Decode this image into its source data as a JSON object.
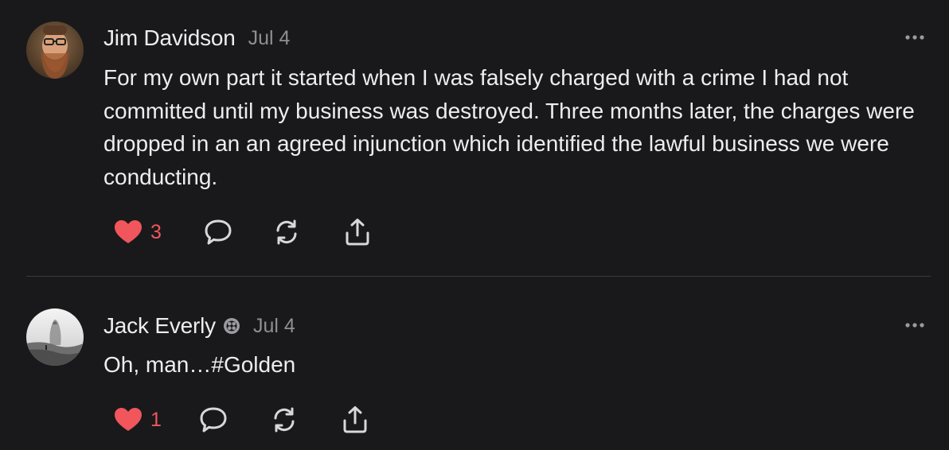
{
  "posts": [
    {
      "author": "Jim Davidson",
      "date": "Jul 4",
      "text": "For my own part it started when I was falsely charged with a crime I had not committed until my business was destroyed. Three months later, the charges were dropped in an an agreed injunction which identified the lawful business we were conducting.",
      "likes": "3",
      "liked": true,
      "verified": false
    },
    {
      "author": "Jack Everly",
      "date": "Jul 4",
      "text": "Oh, man…#Golden",
      "likes": "1",
      "liked": true,
      "verified": true
    }
  ],
  "icons": {
    "like": "heart-icon",
    "reply": "comment-bubble-icon",
    "repost": "repost-arrows-icon",
    "share": "share-upload-icon",
    "more": "more-dots-icon",
    "badge": "badge-icon"
  },
  "colors": {
    "background": "#19191b",
    "text": "#ededed",
    "muted": "#8e8e93",
    "like": "#f0565b",
    "icon": "#d8d8d8",
    "divider": "#3a3a3c"
  }
}
